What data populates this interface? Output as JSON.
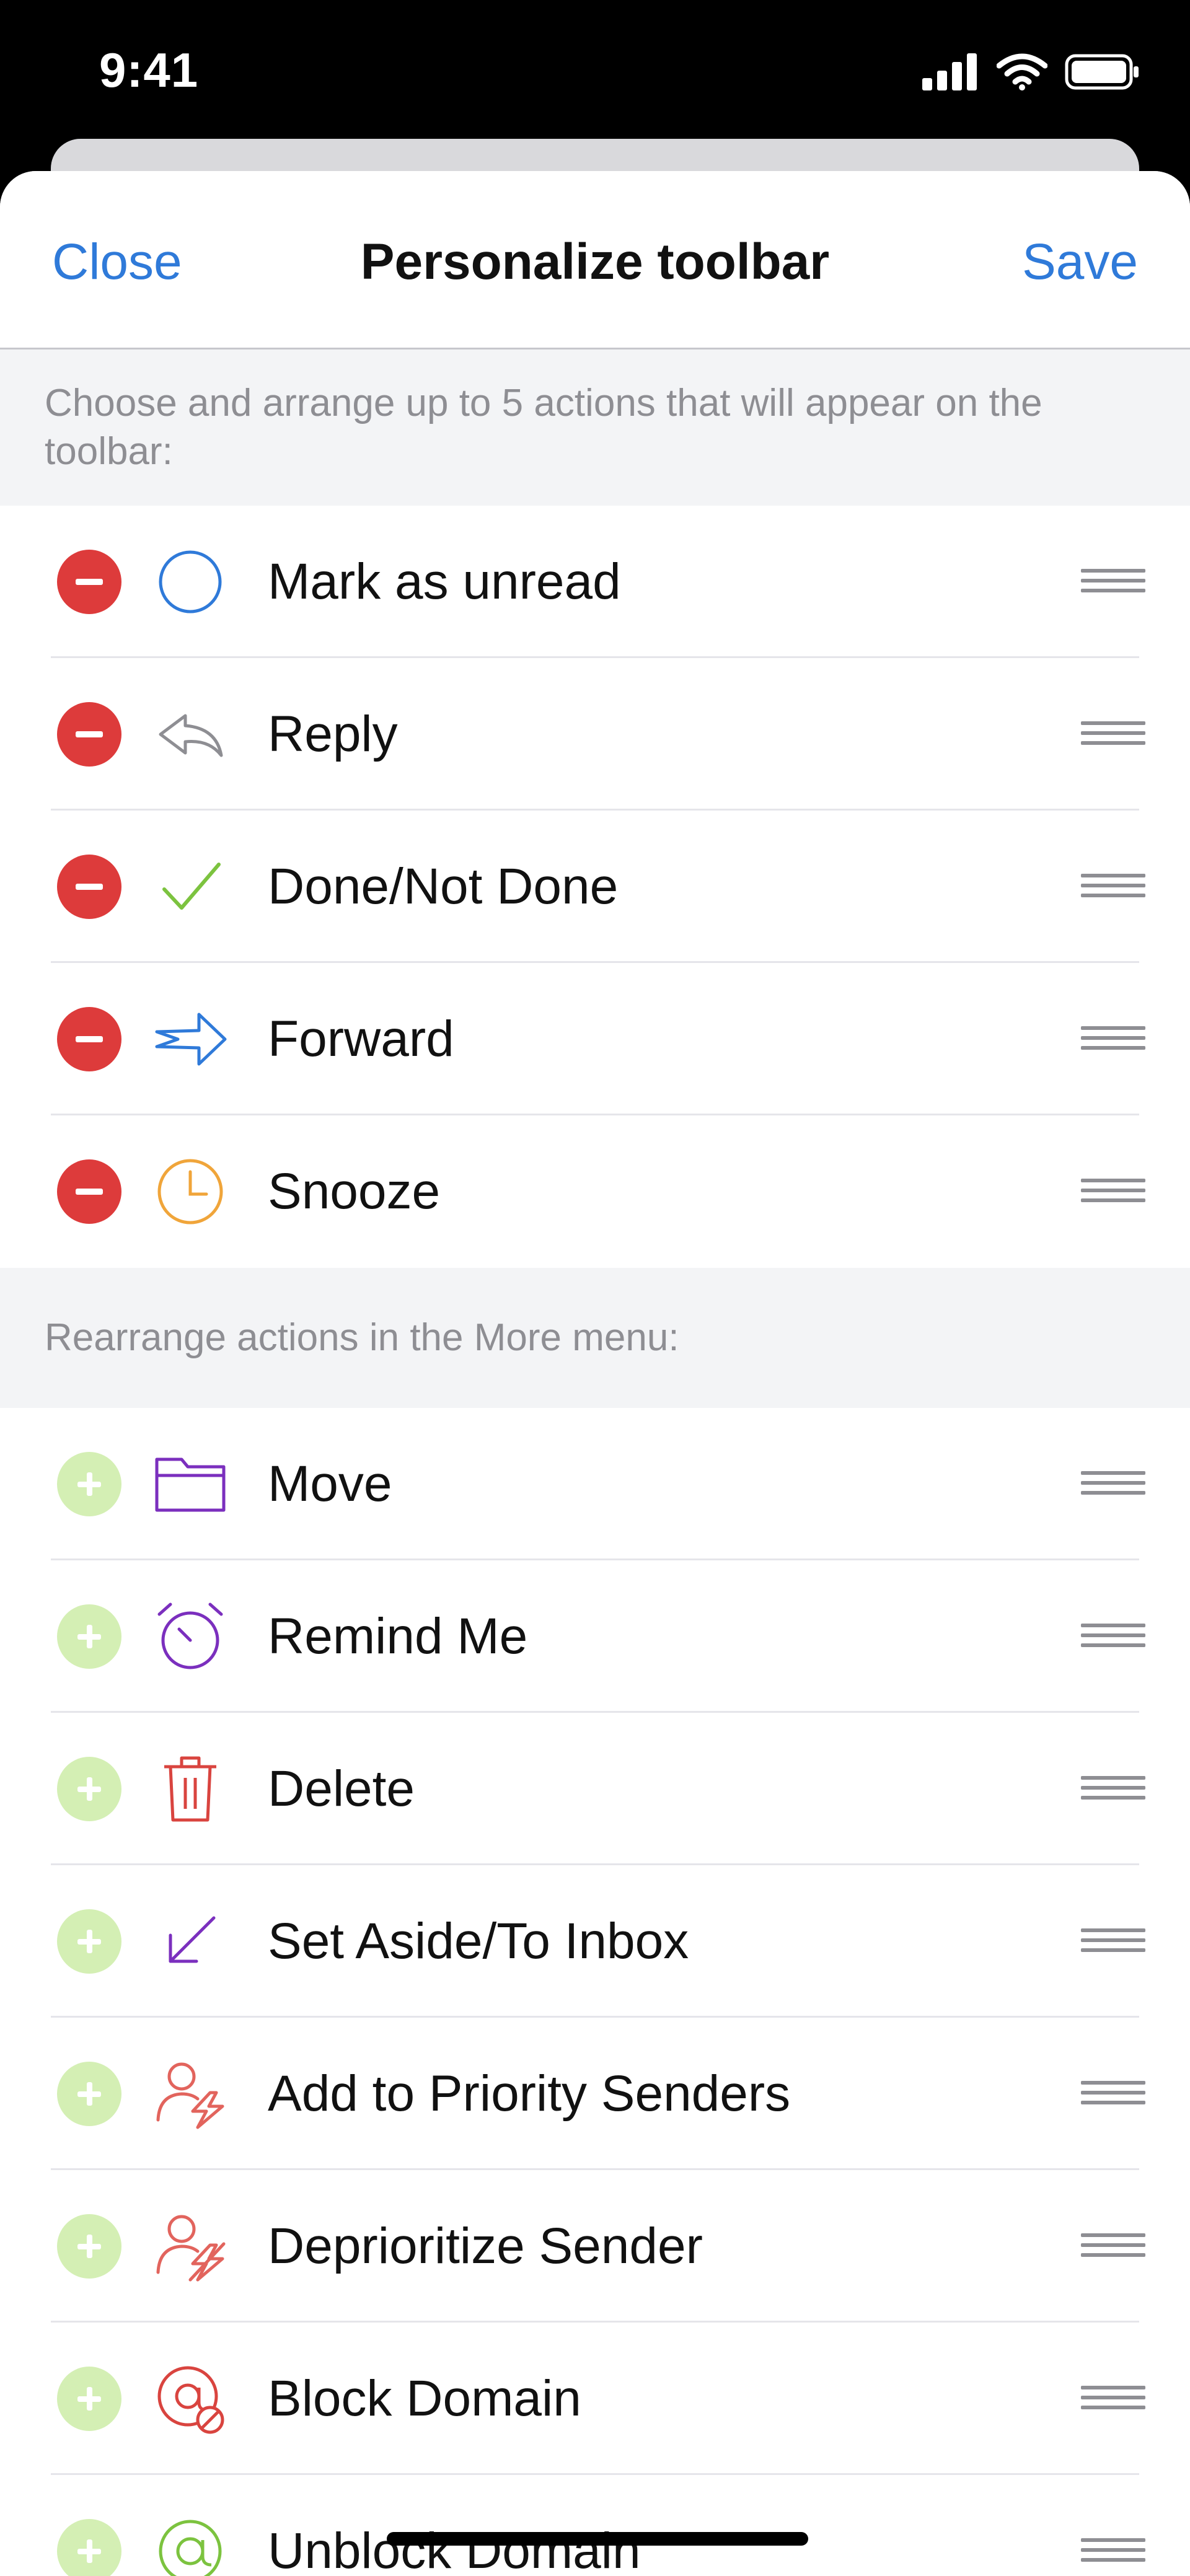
{
  "status_bar": {
    "time": "9:41"
  },
  "nav": {
    "close": "Close",
    "title": "Personalize toolbar",
    "save": "Save"
  },
  "toolbar_section": {
    "header": "Choose and arrange up to 5 actions that will appear on the toolbar:",
    "items": [
      {
        "label": "Mark as unread",
        "icon": "circle-icon"
      },
      {
        "label": "Reply",
        "icon": "reply-icon"
      },
      {
        "label": "Done/Not Done",
        "icon": "checkmark-icon"
      },
      {
        "label": "Forward",
        "icon": "forward-icon"
      },
      {
        "label": "Snooze",
        "icon": "clock-icon"
      }
    ]
  },
  "more_section": {
    "header": "Rearrange actions in the More menu:",
    "items": [
      {
        "label": "Move",
        "icon": "folder-icon"
      },
      {
        "label": "Remind Me",
        "icon": "alarm-icon"
      },
      {
        "label": "Delete",
        "icon": "trash-icon"
      },
      {
        "label": "Set Aside/To Inbox",
        "icon": "arrow-down-left-icon"
      },
      {
        "label": "Add to Priority Senders",
        "icon": "priority-sender-icon"
      },
      {
        "label": "Deprioritize Sender",
        "icon": "deprioritize-sender-icon"
      },
      {
        "label": "Block Domain",
        "icon": "block-domain-icon"
      },
      {
        "label": "Unblock Domain",
        "icon": "at-icon"
      }
    ]
  },
  "colors": {
    "accent_blue": "#2f7ad9",
    "remove_red": "#dd3b3b",
    "add_green": "#d4efb4",
    "icon_gray": "#8e8e93",
    "icon_green": "#7cc33f",
    "icon_orange": "#f0a53a",
    "icon_purple": "#7b2fbe",
    "icon_red": "#d9443f"
  }
}
